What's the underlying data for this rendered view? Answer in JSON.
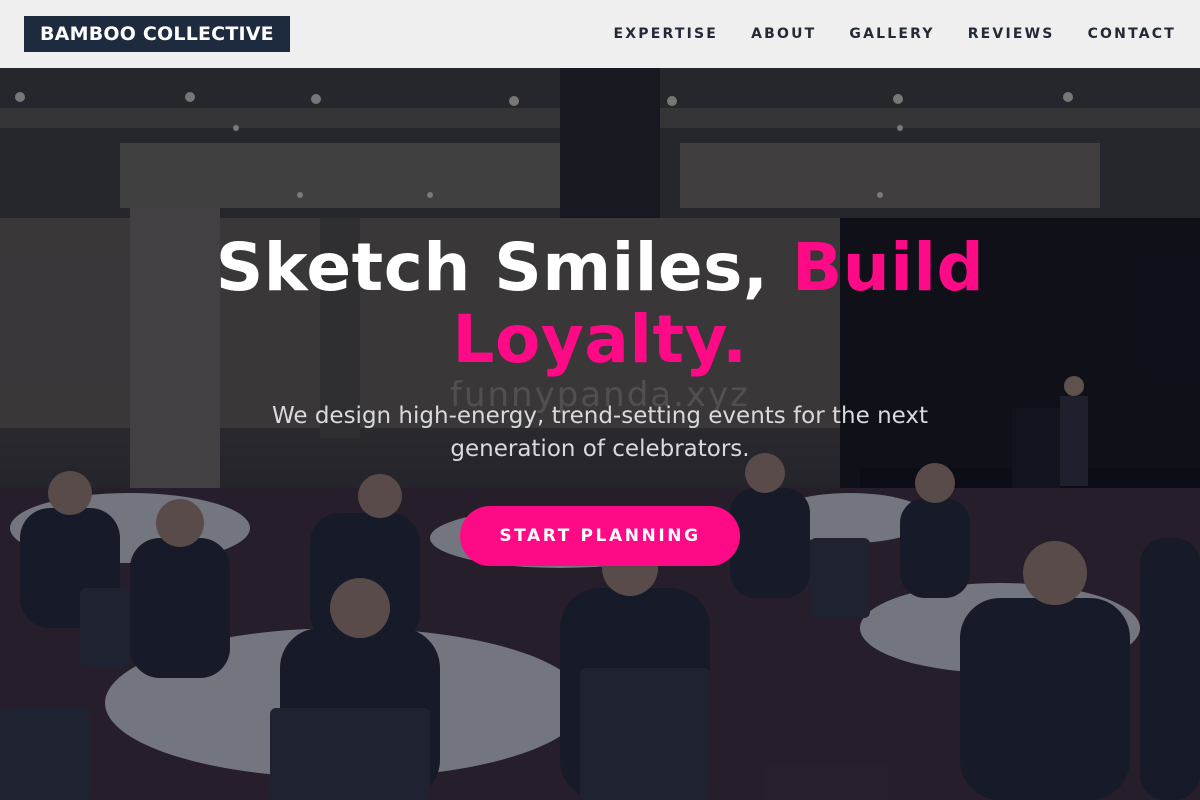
{
  "header": {
    "logo": "BAMBOO COLLECTIVE",
    "nav": [
      {
        "label": "EXPERTISE"
      },
      {
        "label": "ABOUT"
      },
      {
        "label": "GALLERY"
      },
      {
        "label": "REVIEWS"
      },
      {
        "label": "CONTACT"
      }
    ]
  },
  "hero": {
    "headline_part1": "Sketch Smiles,",
    "headline_part2": "Build Loyalty.",
    "subtitle": "We design high-energy, trend-setting events for the next generation of celebrators.",
    "cta_label": "START PLANNING",
    "watermark": "funnypanda.xyz",
    "background_image": "conference-ballroom-photo"
  },
  "colors": {
    "accent": "#ff0a86",
    "logo_bg": "#1e2a3d",
    "header_bg": "#efefef",
    "nav_text": "#222a38"
  }
}
